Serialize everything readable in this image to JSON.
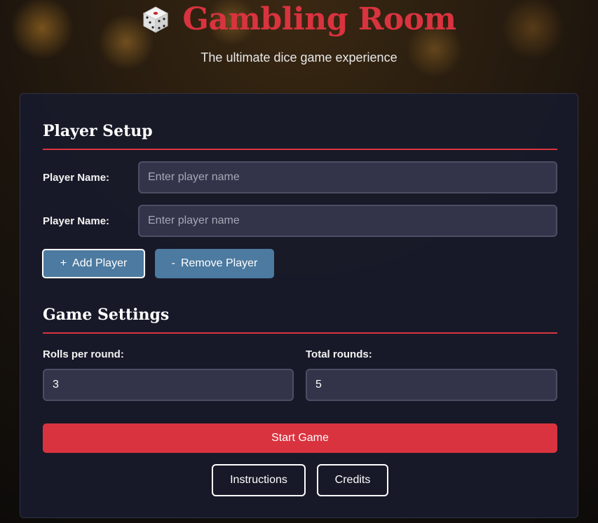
{
  "header": {
    "title": "Gambling Room",
    "subtitle": "The ultimate dice game experience",
    "logo_icon": "die-icon"
  },
  "player_setup": {
    "heading": "Player Setup",
    "players": [
      {
        "label": "Player Name:",
        "value": "",
        "placeholder": "Enter player name"
      },
      {
        "label": "Player Name:",
        "value": "",
        "placeholder": "Enter player name"
      }
    ],
    "add_player": {
      "icon": "+",
      "label": "Add Player"
    },
    "remove_player": {
      "icon": "-",
      "label": "Remove Player"
    }
  },
  "game_settings": {
    "heading": "Game Settings",
    "rolls_per_round": {
      "label": "Rolls per round:",
      "value": "3"
    },
    "total_rounds": {
      "label": "Total rounds:",
      "value": "5"
    }
  },
  "actions": {
    "start_game": "Start Game",
    "instructions": "Instructions",
    "credits": "Credits"
  },
  "colors": {
    "accent": "#d9333f",
    "button_blue": "#4c7aa0",
    "panel_bg": "#181a2a"
  }
}
